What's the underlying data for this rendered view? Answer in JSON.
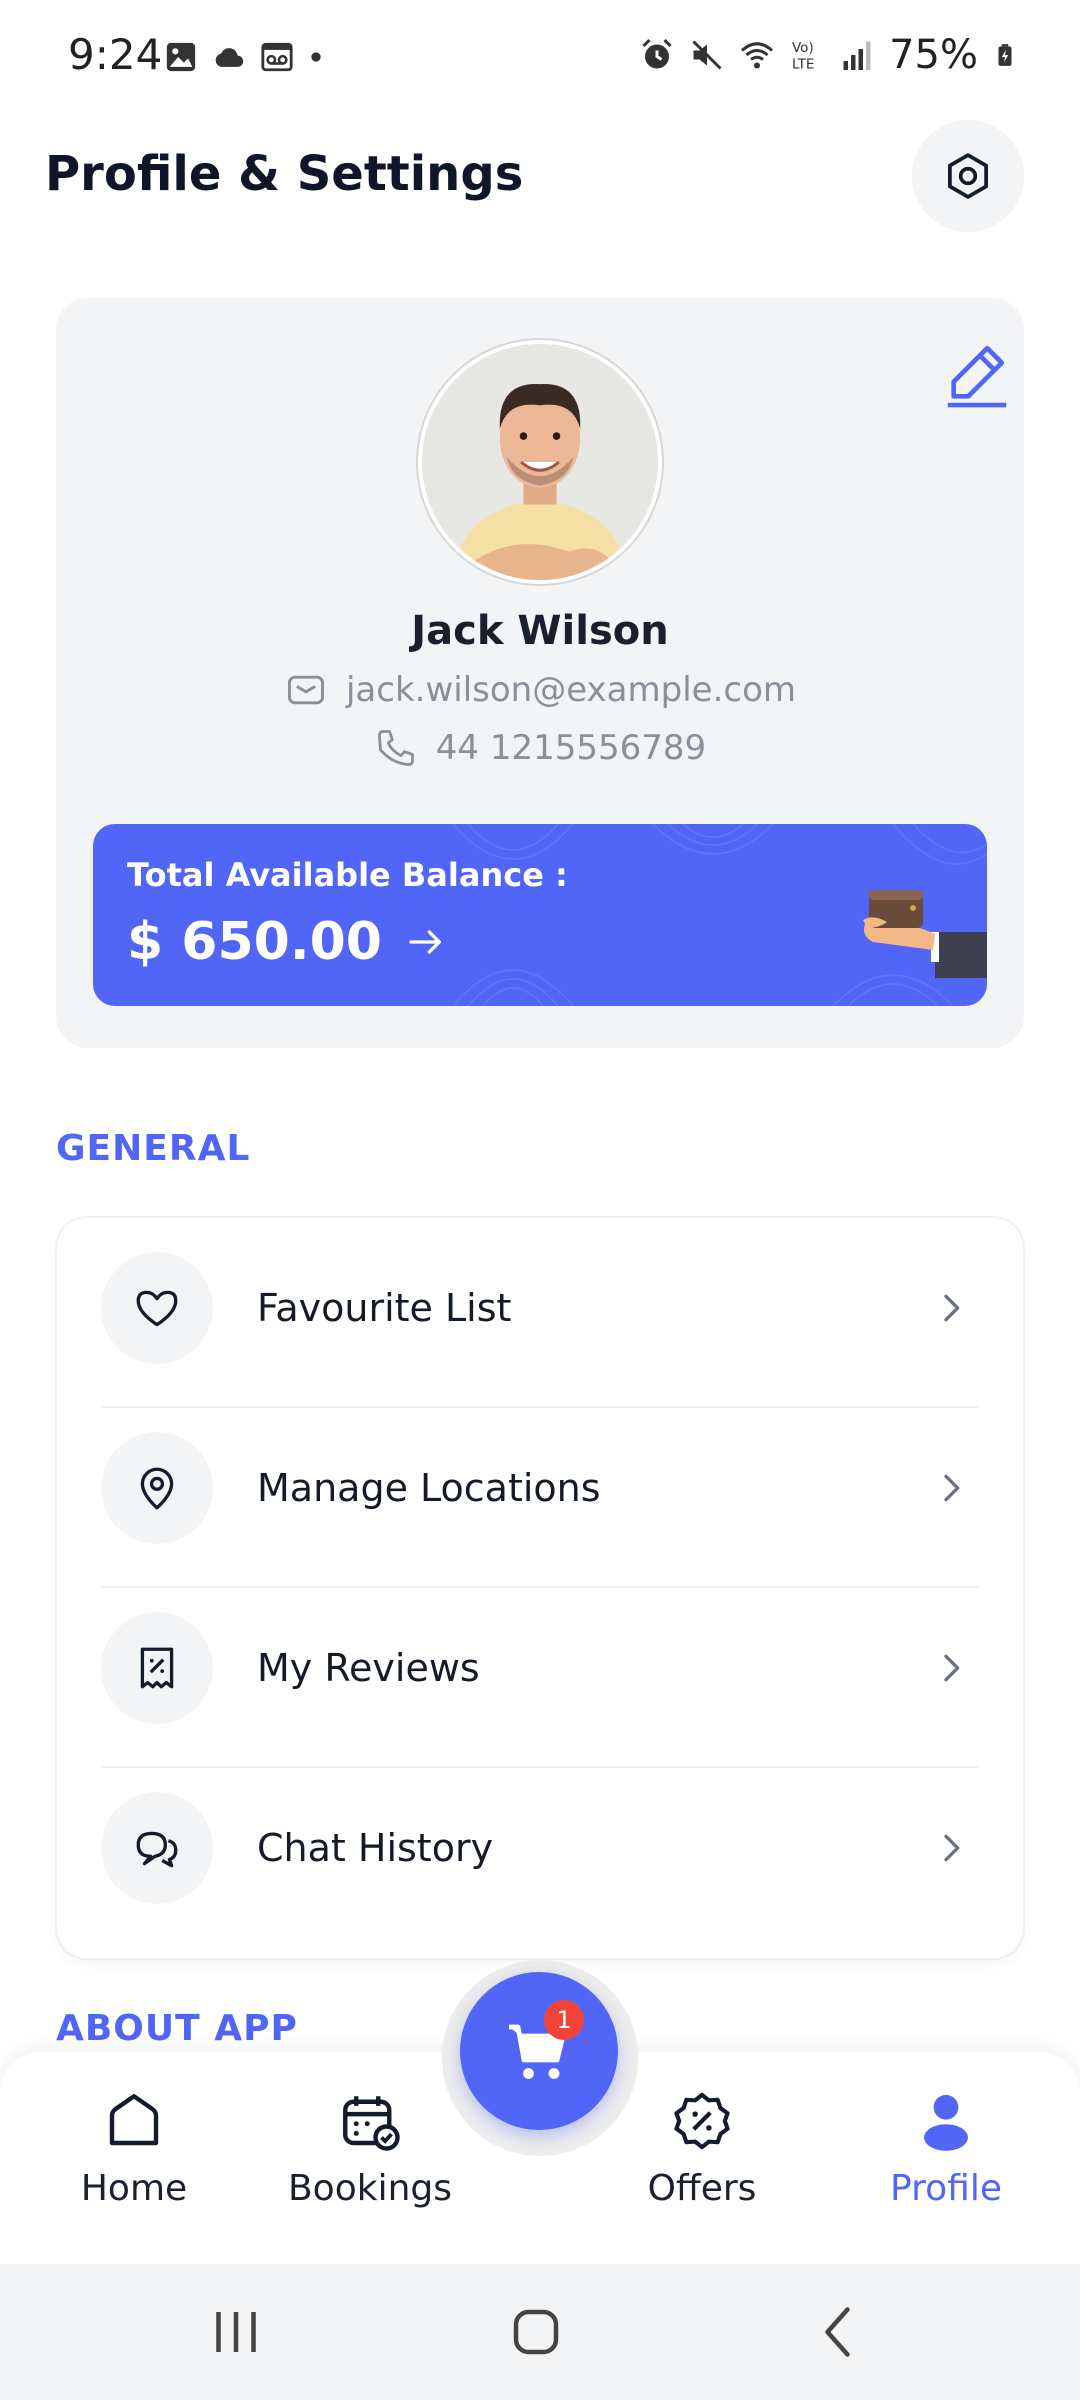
{
  "status_bar": {
    "time": "9:24",
    "battery": "75%",
    "icons_left": [
      "gallery-icon",
      "cloud-icon",
      "voicemail-icon",
      "dot-icon"
    ],
    "icons_right": [
      "alarm-icon",
      "mute-icon",
      "wifi-icon",
      "volte-icon",
      "signal-icon",
      "battery-icon"
    ]
  },
  "header": {
    "title": "Profile & Settings",
    "settings_icon": "settings-icon"
  },
  "profile": {
    "name": "Jack Wilson",
    "email": "jack.wilson@example.com",
    "phone": "44 1215556789",
    "edit_icon": "pencil-icon",
    "balance": {
      "label": "Total Available Balance  :",
      "amount": "$ 650.00"
    }
  },
  "sections": {
    "general": "GENERAL",
    "about": "ABOUT APP"
  },
  "menu": [
    {
      "label": "Favourite List",
      "icon": "heart-icon"
    },
    {
      "label": "Manage Locations",
      "icon": "location-pin-icon"
    },
    {
      "label": "My Reviews",
      "icon": "review-icon"
    },
    {
      "label": "Chat History",
      "icon": "chat-icon"
    }
  ],
  "bottom_nav": {
    "home": "Home",
    "bookings": "Bookings",
    "offers": "Offers",
    "profile": "Profile",
    "active": "profile"
  },
  "cart": {
    "badge": "1"
  },
  "colors": {
    "accent": "#5165F6",
    "card_bg": "#F3F4F6",
    "badge": "#F04438",
    "text_primary": "#141B2D",
    "text_muted": "#8A8F9A"
  }
}
